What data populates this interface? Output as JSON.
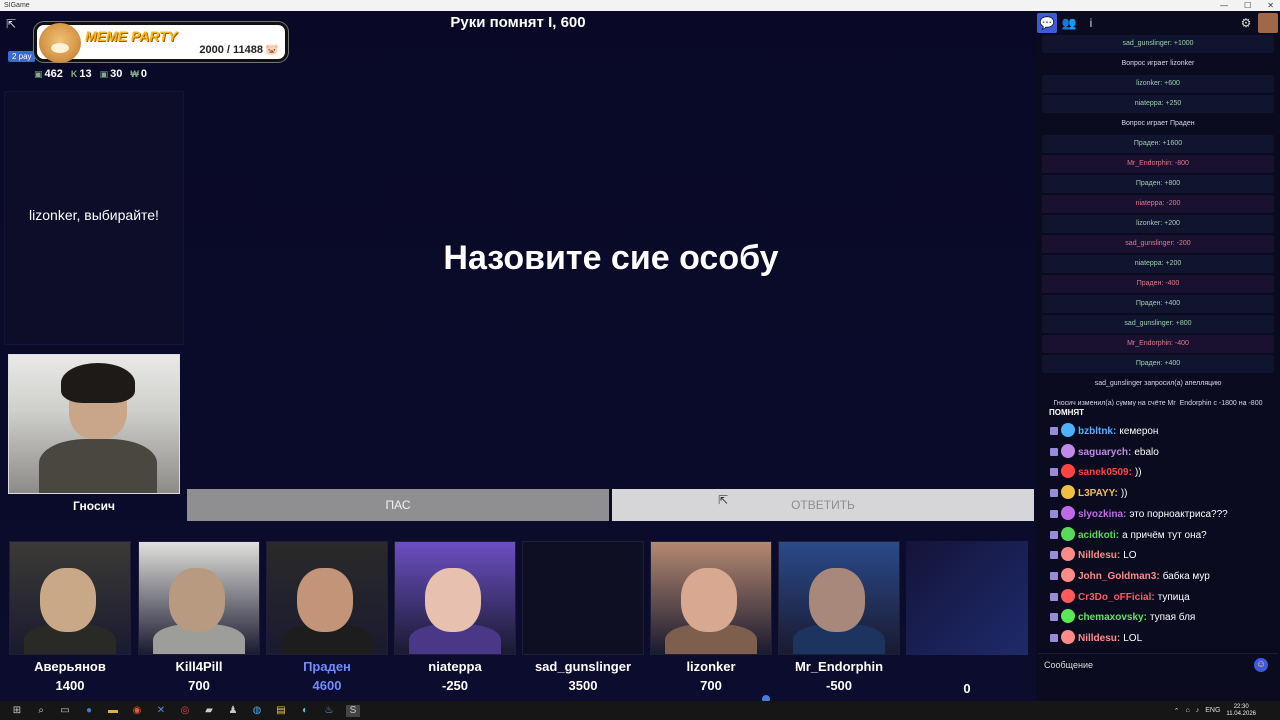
{
  "window": {
    "title": "SIGame",
    "minimize": "—",
    "maximize": "☐",
    "close": "✕"
  },
  "game": {
    "round_title": "Руки помнят I, 600",
    "question": "Назовите сие особу",
    "chooser_text": "lizonker, выбирайте!",
    "round_chip": "2 рау",
    "host_name": "Гносич",
    "pass_label": "ПАС",
    "answer_label": "ОТВЕТИТЬ"
  },
  "overlay": {
    "brand": "MEME PARTY",
    "score": "2000 / 11488",
    "stats": [
      "462",
      "13",
      "30",
      "0"
    ]
  },
  "players": [
    {
      "name": "Аверьянов",
      "score": "1400",
      "active": false,
      "colors": [
        "#c9a888",
        "#3b3a35"
      ]
    },
    {
      "name": "Kill4Pill",
      "score": "700",
      "active": false,
      "colors": [
        "#b89a80",
        "#e0e0dc"
      ]
    },
    {
      "name": "Праден",
      "score": "4600",
      "active": true,
      "colors": [
        "#c49478",
        "#2a2a2a"
      ]
    },
    {
      "name": "niateppa",
      "score": "-250",
      "active": false,
      "colors": [
        "#e7c0b0",
        "#6b4fc2"
      ]
    },
    {
      "name": "sad_gunslinger",
      "score": "3500",
      "active": false,
      "colors": [
        "#0f0f24",
        "#0f0f24"
      ]
    },
    {
      "name": "lizonker",
      "score": "700",
      "active": false,
      "colors": [
        "#d8a890",
        "#b48870"
      ]
    },
    {
      "name": "Mr_Endorphin",
      "score": "-500",
      "active": false,
      "colors": [
        "#a8887a",
        "#2a4a8a"
      ]
    }
  ],
  "empty_slot_score": "0",
  "log": [
    {
      "text": "sad_gunslinger: +1000",
      "kind": "pos"
    },
    {
      "text": "Вопрос играет lizonker",
      "kind": "info"
    },
    {
      "text": "lizonker: +600",
      "kind": "pos"
    },
    {
      "text": "niateppa: +250",
      "kind": "pos"
    },
    {
      "text": "Вопрос играет Праден",
      "kind": "info"
    },
    {
      "text": "Праден: +1600",
      "kind": "pos"
    },
    {
      "text": "Mr_Endorphin: -800",
      "kind": "neg"
    },
    {
      "text": "Праден: +800",
      "kind": "pos"
    },
    {
      "text": "niateppa: -200",
      "kind": "neg"
    },
    {
      "text": "lizonker: +200",
      "kind": "pos"
    },
    {
      "text": "sad_gunslinger: -200",
      "kind": "neg"
    },
    {
      "text": "niateppa: +200",
      "kind": "pos"
    },
    {
      "text": "Праден: -400",
      "kind": "neg"
    },
    {
      "text": "Праден: +400",
      "kind": "pos"
    },
    {
      "text": "sad_gunslinger: +800",
      "kind": "pos"
    },
    {
      "text": "Mr_Endorphin: -400",
      "kind": "neg"
    },
    {
      "text": "Праден: +400",
      "kind": "pos"
    },
    {
      "text": "sad_gunslinger запросил(а) апелляцию",
      "kind": "info"
    },
    {
      "text": "Гносич изменил(а) сумму на счёте Mr_Endorphin с -1800 на -800",
      "kind": "info"
    }
  ],
  "chat": {
    "header": "ПОМНЯТ",
    "lines": [
      {
        "nick": "bzbltnk:",
        "msg": "кемерон",
        "color": "#4fb0ff"
      },
      {
        "nick": "saguarych:",
        "msg": "ebalo",
        "color": "#c08ae8"
      },
      {
        "nick": "sanek0509:",
        "msg": "))",
        "color": "#ff4444"
      },
      {
        "nick": "L3PAYY:",
        "msg": "))",
        "color": "#f0c040"
      },
      {
        "nick": "slyozkina:",
        "msg": "это порноактриса???",
        "color": "#c06ae8"
      },
      {
        "nick": "acidkoti:",
        "msg": "а причём тут она?",
        "color": "#58d858"
      },
      {
        "nick": "Nilldesu:",
        "msg": "LO",
        "color": "#ff8a8a"
      },
      {
        "nick": "John_Goldman3:",
        "msg": "бабка мур",
        "color": "#ff8a8a"
      },
      {
        "nick": "Cr3Do_oFFicial:",
        "msg": "тупица",
        "color": "#ff5a5a"
      },
      {
        "nick": "chemaxovsky:",
        "msg": "тупая бля",
        "color": "#58e858"
      },
      {
        "nick": "Nilldesu:",
        "msg": "LOL",
        "color": "#ff8a8a"
      }
    ],
    "input_placeholder": "Сообщение"
  },
  "taskbar": {
    "lang": "ENG",
    "time": "22:30",
    "date": "11.04.2026"
  }
}
